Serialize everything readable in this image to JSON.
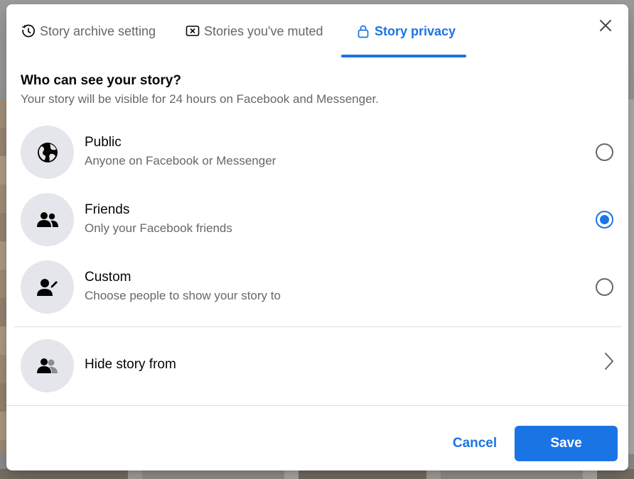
{
  "tabs": [
    {
      "label": "Story archive setting",
      "icon": "history-clock-icon"
    },
    {
      "label": "Stories you've muted",
      "icon": "muted-box-icon"
    },
    {
      "label": "Story privacy",
      "icon": "lock-icon"
    }
  ],
  "active_tab": "Story privacy",
  "heading": "Who can see your story?",
  "subheading": "Your story will be visible for 24 hours on Facebook and Messenger.",
  "options": [
    {
      "title": "Public",
      "desc": "Anyone on Facebook or Messenger",
      "icon": "globe-icon",
      "selected": false
    },
    {
      "title": "Friends",
      "desc": "Only your Facebook friends",
      "icon": "friends-icon",
      "selected": true
    },
    {
      "title": "Custom",
      "desc": "Choose people to show your story to",
      "icon": "person-edit-icon",
      "selected": false
    }
  ],
  "hide_row": {
    "title": "Hide story from",
    "icon": "friends-hide-icon"
  },
  "footer": {
    "cancel_label": "Cancel",
    "save_label": "Save"
  },
  "colors": {
    "accent": "#1b74e4",
    "text_primary": "#050505",
    "text_secondary": "#65676b",
    "icon_bg": "#e4e6eb"
  }
}
